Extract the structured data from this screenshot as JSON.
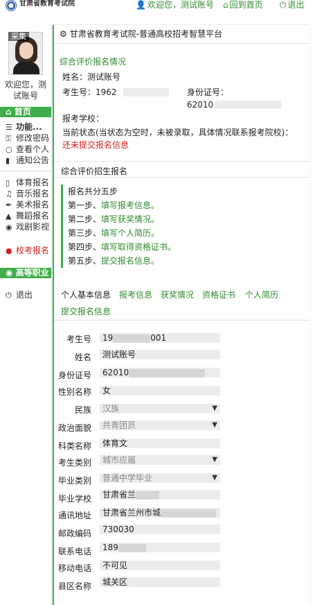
{
  "topbar": {
    "logo_text": "甘肃省教育考试院",
    "welcome_link": "欢迎您，测试账号",
    "home_link": "回到首页",
    "logout_link": "退出",
    "accent": "#2e8b2e"
  },
  "sidebar": {
    "avatar_badge": "采集",
    "welcome_line1": "欢迎您，测",
    "welcome_line2": "试账号",
    "home": "首页",
    "function_group": "功能...",
    "items": [
      {
        "label": "修改密码",
        "icon": "key-icon"
      },
      {
        "label": "查看个人",
        "icon": "user-icon"
      },
      {
        "label": "通知公告",
        "icon": "file-icon"
      }
    ],
    "exam_items": [
      {
        "label": "体育报名",
        "icon": "mobile-icon"
      },
      {
        "label": "音乐报名",
        "icon": "music-icon"
      },
      {
        "label": "美术报名",
        "icon": "brush-icon"
      },
      {
        "label": "舞蹈报名",
        "icon": "dance-icon"
      },
      {
        "label": "戏剧影视",
        "icon": "film-icon"
      }
    ],
    "school_exam": "校考报名",
    "higher_vocational": "高等职业",
    "logout": "退出",
    "green": "#3fae49",
    "red": "#d42020"
  },
  "header": {
    "title": "甘肃省教育考试院-普通高校招考智慧平台"
  },
  "summary": {
    "title": "综合评价报名情况",
    "name_label": "姓名：测试账号",
    "exam_no_label": "考生号：",
    "exam_no_visible": "1962",
    "id_label": "身份证号：",
    "id_visible": "62010",
    "school_label": "报考学校：",
    "status_label": "当前状态(当状态为空时，未被录取，具体情况联系报考院校)：",
    "status_value": "还未提交报名信息"
  },
  "registration": {
    "title": "综合评价招生报名",
    "steps_intro": "报名共分五步",
    "steps": [
      {
        "prefix": "第一步、",
        "action": "填写报考信息。"
      },
      {
        "prefix": "第二步、",
        "action": "填写获奖情况。"
      },
      {
        "prefix": "第三步、",
        "action": "填写个人简历。"
      },
      {
        "prefix": "第四步、",
        "action": "填写取得资格证书。"
      },
      {
        "prefix": "第五步、",
        "action": "提交报名信息。"
      }
    ]
  },
  "tabs": [
    "个人基本信息",
    "报考信息",
    "获奖情况",
    "资格证书",
    "个人简历",
    "提交报名信息"
  ],
  "form": {
    "fields": [
      {
        "label": "考生号",
        "value": "19",
        "suffix": "001",
        "masked": true
      },
      {
        "label": "姓名",
        "value": "测试账号"
      },
      {
        "label": "身份证号",
        "value": "62010",
        "masked": true
      },
      {
        "label": "性别名称",
        "value": "女"
      },
      {
        "label": "民族",
        "value": "汉族",
        "select": true
      },
      {
        "label": "政治面貌",
        "value": "共青团员",
        "select": true
      },
      {
        "label": "科类名称",
        "value": "体育文"
      },
      {
        "label": "考生类别",
        "value": "城市应届",
        "select": true
      },
      {
        "label": "毕业类别",
        "value": "普通中学毕业",
        "select": true
      },
      {
        "label": "毕业学校",
        "value": "甘肃省兰",
        "masked": true
      },
      {
        "label": "通讯地址",
        "value": "甘肃省兰州市城",
        "masked": true
      },
      {
        "label": "邮政编码",
        "value": "730030"
      },
      {
        "label": "联系电话",
        "value": "189",
        "masked": true
      },
      {
        "label": "移动电话",
        "value": "不可见"
      },
      {
        "label": "县区名称",
        "value": "城关区"
      }
    ]
  }
}
